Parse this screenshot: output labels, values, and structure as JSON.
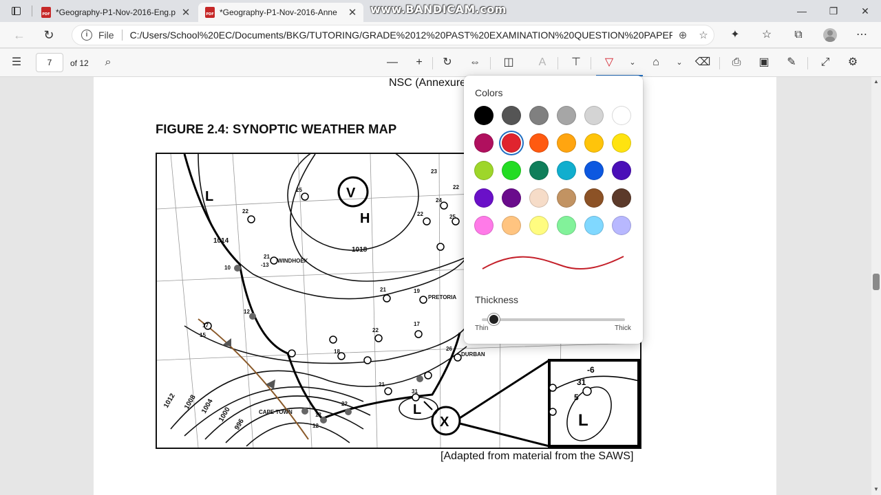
{
  "browser": {
    "tabs": [
      {
        "title": "*Geography-P1-Nov-2016-Eng.p",
        "active": false
      },
      {
        "title": "*Geography-P1-Nov-2016-Anne",
        "active": true
      }
    ],
    "watermark": "www.BANDICAM.com",
    "file_label": "File",
    "url": "C:/Users/School%20EC/Documents/BKG/TUTORING/GRADE%2012%20PAST%20EXAMINATION%20QUESTION%20PAPERS/..."
  },
  "pdf_toolbar": {
    "page_number": "7",
    "page_count_label": "of 12"
  },
  "document": {
    "header": "NSC (Annexure)",
    "figure_title": "FIGURE 2.4:  SYNOPTIC WEATHER MAP",
    "caption": "[Adapted from material from the SAWS]",
    "map": {
      "symbols": {
        "L_top": "L",
        "V": "V",
        "H": "H",
        "L_bottom": "L",
        "X": "X",
        "L_inset": "L"
      },
      "isobar_labels": {
        "p1014": "1014",
        "p1018": "1018",
        "p1012": "1012",
        "p1008": "1008",
        "p1004": "1004",
        "p1000": "1000",
        "p996": "996"
      },
      "places": {
        "windhoek": "WINDHOEK",
        "pretoria": "PRETORIA",
        "durban": "DURBAN",
        "cape_town": "CAPE TOWN"
      },
      "station_values": {
        "s25": "25",
        "s22a": "22",
        "s23": "23",
        "s22b": "22",
        "s24": "24",
        "s22c": "22",
        "s25b": "25",
        "s21a": "21",
        "s13": "-13",
        "s10": "10",
        "s21b": "21",
        "s12": "12",
        "s19": "19",
        "s17": "17",
        "s15": "15",
        "s22d": "22",
        "s17b": "17",
        "s18": "18",
        "s26": "26",
        "s21c": "21",
        "s31": "31",
        "s22e": "22",
        "s12b": "12",
        "s12c": "12",
        "inset31": "31",
        "inset5": "5",
        "inset6": "-6"
      }
    }
  },
  "ink_popup": {
    "colors_label": "Colors",
    "colors": [
      "#000000",
      "#555555",
      "#808080",
      "#a6a6a6",
      "#d4d4d4",
      "#ffffff",
      "#b0105e",
      "#e0242e",
      "#ff5a10",
      "#ffa510",
      "#ffc40a",
      "#ffe310",
      "#9ed62a",
      "#23dc23",
      "#0f7e5a",
      "#11aece",
      "#0c58e0",
      "#4a0fb8",
      "#6a10c8",
      "#6a0c8c",
      "#f6dcc8",
      "#c29362",
      "#8c5226",
      "#5c3a2a",
      "#ff7ae8",
      "#ffc480",
      "#fffc80",
      "#82f29a",
      "#80d8ff",
      "#b8b8ff"
    ],
    "selected_color": "#e0242e",
    "thickness_label": "Thickness",
    "thickness_value": 0.05,
    "thin_label": "Thin",
    "thick_label": "Thick"
  }
}
